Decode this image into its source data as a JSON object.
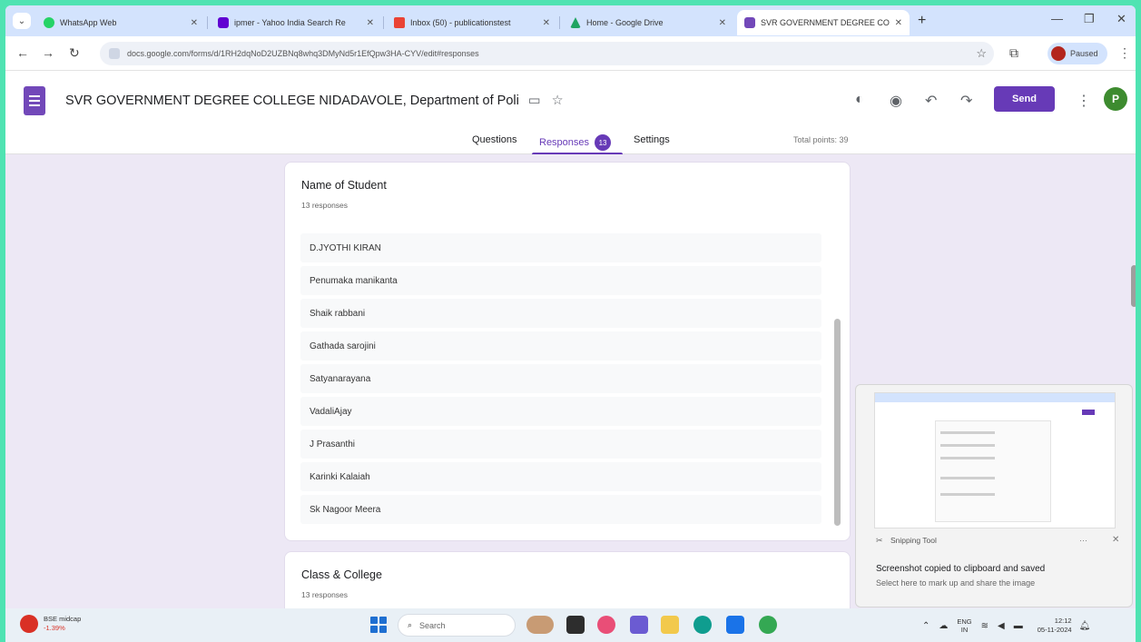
{
  "browser": {
    "tabs": [
      {
        "title": "WhatsApp Web",
        "color": "#25d366"
      },
      {
        "title": "ipmer - Yahoo India Search Re",
        "color": "#6001d2"
      },
      {
        "title": "Inbox (50) - publicationstest",
        "color": "#ea4335"
      },
      {
        "title": "Home - Google Drive",
        "color": "#1fa463"
      },
      {
        "title": "SVR GOVERNMENT DEGREE CO",
        "color": "#7248b9"
      }
    ],
    "url": "docs.google.com/forms/d/1RH2dqNoD2UZBNq8whq3DMyNd5r1EfQpw3HA-CYV/edit#responses",
    "profile_label": "Paused"
  },
  "form": {
    "title": "SVR GOVERNMENT DEGREE COLLEGE NIDADAVOLE, Department of Poli",
    "send_label": "Send",
    "avatar_letter": "P",
    "tabs": {
      "questions": "Questions",
      "responses": "Responses",
      "responses_count": "13",
      "settings": "Settings"
    },
    "total_points": "Total points: 39"
  },
  "cards": {
    "name": {
      "title": "Name of Student",
      "count": "13 responses",
      "responses": [
        "D.JYOTHI KIRAN",
        "Penumaka manikanta",
        "Shaik rabbani",
        "Gathada sarojini",
        "Satyanarayana",
        "VadaliAjay",
        "J Prasanthi",
        "Karinki Kalaiah",
        "Sk Nagoor Meera"
      ]
    },
    "class_college": {
      "title": "Class & College",
      "count": "13 responses"
    }
  },
  "snip": {
    "app": "Snipping Tool",
    "message": "Screenshot copied to clipboard and saved",
    "sub": "Select here to mark up and share the image"
  },
  "taskbar": {
    "weather_title": "BSE midcap",
    "weather_value": "-1.39%",
    "search_placeholder": "Search",
    "lang_top": "ENG",
    "lang_bottom": "IN",
    "time": "12:12",
    "date": "05-11-2024"
  }
}
